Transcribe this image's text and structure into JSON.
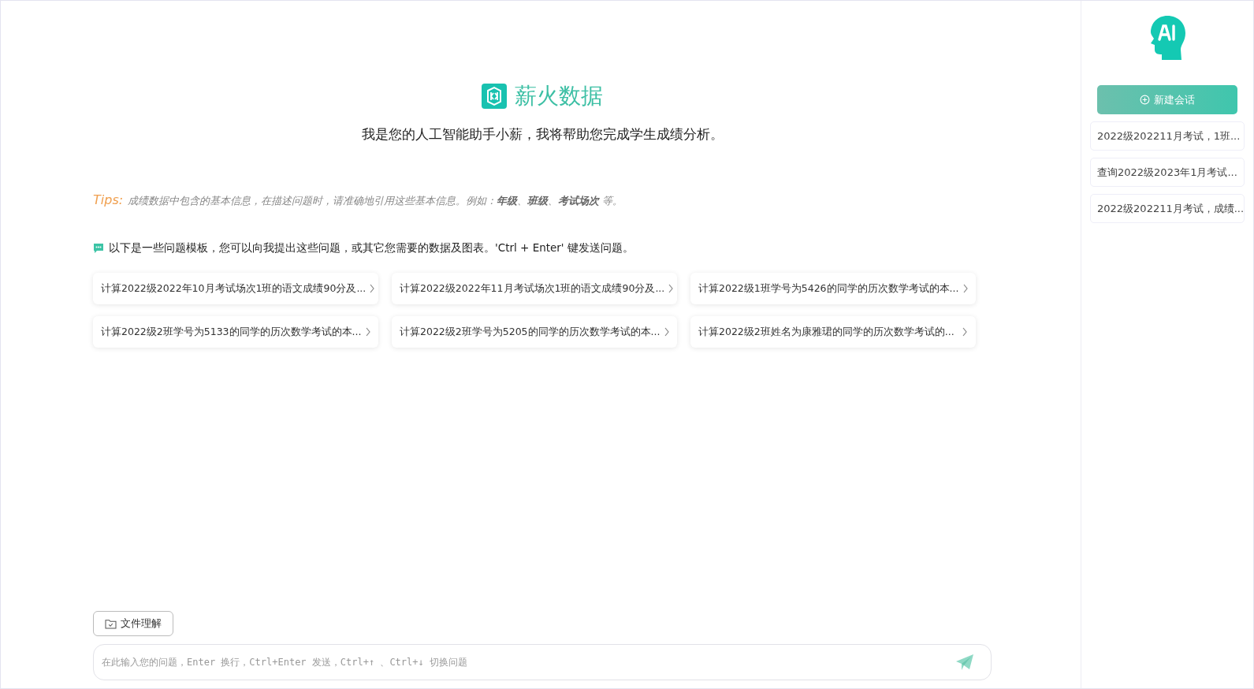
{
  "brand": {
    "name": "薪火数据",
    "subtitle": "我是您的人工智能助手小薪，我将帮助您完成学生成绩分析。"
  },
  "tips": {
    "label": "Tips:",
    "text": "成绩数据中包含的基本信息，在描述问题时，请准确地引用这些基本信息。例如：**年级**、**班级**、**考试场次** 等。"
  },
  "templates_intro": "以下是一些问题模板，您可以向我提出这些问题，或其它您需要的数据及图表。'Ctrl + Enter' 键发送问题。",
  "templates": [
    {
      "text": "计算2022级2022年10月考试场次1班的语文成绩90分及..."
    },
    {
      "text": "计算2022级2022年11月考试场次1班的语文成绩90分及..."
    },
    {
      "text": "计算2022级1班学号为5426的同学的历次数学考试的本..."
    },
    {
      "text": "计算2022级2班学号为5133的同学的历次数学考试的本..."
    },
    {
      "text": "计算2022级2班学号为5205的同学的历次数学考试的本..."
    },
    {
      "text": "计算2022级2班姓名为康雅珺的同学的历次数学考试的..."
    }
  ],
  "file_button": "文件理解",
  "input": {
    "placeholder": "在此输入您的问题，Enter 换行，Ctrl+Enter 发送，Ctrl+↑ 、Ctrl+↓ 切换问题"
  },
  "sidebar": {
    "new_chat": "新建会话",
    "sessions": [
      {
        "title": "2022级202211月考试，1班..."
      },
      {
        "title": "查询2022级2023年1月考试..."
      },
      {
        "title": "2022级202211月考试，成绩..."
      }
    ]
  }
}
